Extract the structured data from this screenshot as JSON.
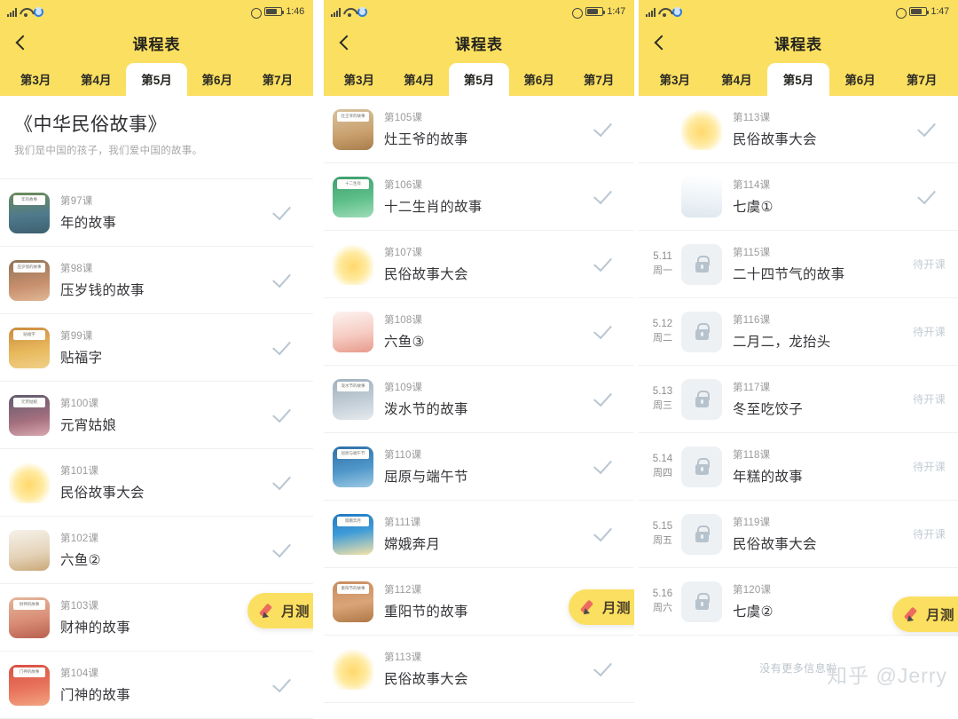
{
  "app": {
    "title": "课程表",
    "back_icon": "chevron-left-icon"
  },
  "statusbar": {
    "signal_icon": "signal-bars-icon",
    "wifi_icon": "wifi-icon",
    "rotate_icon": "rotation-lock-icon",
    "alarm_icon": "alarm-clock-icon",
    "battery_icon": "battery-icon",
    "time_p1": "1:46",
    "time_p2": "1:47",
    "time_p3": "1:47"
  },
  "tabs": [
    {
      "label": "第3月",
      "active": false
    },
    {
      "label": "第4月",
      "active": false
    },
    {
      "label": "第5月",
      "active": true
    },
    {
      "label": "第6月",
      "active": false
    },
    {
      "label": "第7月",
      "active": false
    }
  ],
  "course": {
    "title": "《中华民俗故事》",
    "subtitle": "我们是中国的孩子，我们爱中国的故事。"
  },
  "fab": {
    "label": "月测",
    "icon": "pencil-icon"
  },
  "status_labels": {
    "completed_icon": "checkmark-icon",
    "locked_icon": "lock-icon",
    "pending": "待开课"
  },
  "footer": {
    "no_more": "没有更多信息啦",
    "watermark": "知乎 @Jerry"
  },
  "panel1_lessons": [
    {
      "no": "第97课",
      "title": "年的故事",
      "thumb_caption": "年的故事",
      "art": "a1",
      "status": "done"
    },
    {
      "no": "第98课",
      "title": "压岁钱的故事",
      "thumb_caption": "压岁钱的故事",
      "art": "a2",
      "status": "done"
    },
    {
      "no": "第99课",
      "title": "贴福字",
      "thumb_caption": "贴福字",
      "art": "a3",
      "status": "done"
    },
    {
      "no": "第100课",
      "title": "元宵姑娘",
      "thumb_caption": "元宵姑娘",
      "art": "a4",
      "status": "done"
    },
    {
      "no": "第101课",
      "title": "民俗故事大会",
      "thumb_caption": "",
      "art": "a5",
      "status": "done"
    },
    {
      "no": "第102课",
      "title": "六鱼②",
      "thumb_caption": "",
      "art": "a6",
      "status": "done"
    },
    {
      "no": "第103课",
      "title": "财神的故事",
      "thumb_caption": "财神的故事",
      "art": "a7",
      "status": "done"
    },
    {
      "no": "第104课",
      "title": "门神的故事",
      "thumb_caption": "门神的故事",
      "art": "a8",
      "status": "done"
    }
  ],
  "panel2_lessons": [
    {
      "no": "第105课",
      "title": "灶王爷的故事",
      "thumb_caption": "灶王爷的故事",
      "art": "a9",
      "status": "done"
    },
    {
      "no": "第106课",
      "title": "十二生肖的故事",
      "thumb_caption": "十二生肖",
      "art": "a10",
      "status": "done"
    },
    {
      "no": "第107课",
      "title": "民俗故事大会",
      "thumb_caption": "",
      "art": "a5",
      "status": "done"
    },
    {
      "no": "第108课",
      "title": "六鱼③",
      "thumb_caption": "",
      "art": "a11",
      "status": "done"
    },
    {
      "no": "第109课",
      "title": "泼水节的故事",
      "thumb_caption": "泼水节的故事",
      "art": "a12",
      "status": "done"
    },
    {
      "no": "第110课",
      "title": "屈原与端午节",
      "thumb_caption": "屈原与端午节",
      "art": "a13",
      "status": "done"
    },
    {
      "no": "第111课",
      "title": "嫦娥奔月",
      "thumb_caption": "嫦娥奔月",
      "art": "a14",
      "status": "done"
    },
    {
      "no": "第112课",
      "title": "重阳节的故事",
      "thumb_caption": "重阳节的故事",
      "art": "a15",
      "status": "done"
    },
    {
      "no": "第113课",
      "title": "民俗故事大会",
      "thumb_caption": "",
      "art": "a5",
      "status": "done"
    }
  ],
  "panel3_lessons": [
    {
      "no": "第113课",
      "title": "民俗故事大会",
      "thumb_caption": "",
      "art": "a5",
      "status": "done",
      "date": "",
      "dow": ""
    },
    {
      "no": "第114课",
      "title": "七虞①",
      "thumb_caption": "",
      "art": "a16",
      "status": "done",
      "date": "",
      "dow": ""
    },
    {
      "no": "第115课",
      "title": "二十四节气的故事",
      "thumb_caption": "",
      "art": "",
      "status": "locked",
      "date": "5.11",
      "dow": "周一"
    },
    {
      "no": "第116课",
      "title": "二月二，龙抬头",
      "thumb_caption": "",
      "art": "",
      "status": "locked",
      "date": "5.12",
      "dow": "周二"
    },
    {
      "no": "第117课",
      "title": "冬至吃饺子",
      "thumb_caption": "",
      "art": "",
      "status": "locked",
      "date": "5.13",
      "dow": "周三"
    },
    {
      "no": "第118课",
      "title": "年糕的故事",
      "thumb_caption": "",
      "art": "",
      "status": "locked",
      "date": "5.14",
      "dow": "周四"
    },
    {
      "no": "第119课",
      "title": "民俗故事大会",
      "thumb_caption": "",
      "art": "",
      "status": "locked",
      "date": "5.15",
      "dow": "周五"
    },
    {
      "no": "第120课",
      "title": "七虞②",
      "thumb_caption": "",
      "art": "",
      "status": "locked",
      "date": "5.16",
      "dow": "周六"
    }
  ],
  "colors": {
    "brand_yellow": "#fbdf60",
    "check_gray": "#b9c6d2",
    "pending_gray": "#c4ccd4",
    "pencil_red": "#ec6b5e"
  }
}
